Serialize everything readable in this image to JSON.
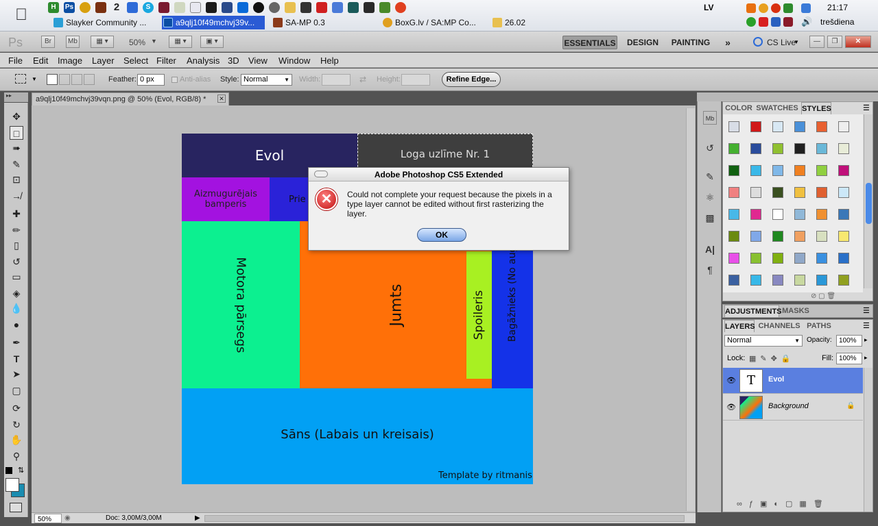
{
  "taskbar": {
    "tasks": [
      {
        "label": "Slayker Community ...",
        "color": "#2a9fd6"
      },
      {
        "label": "a9qlj10f49mchvj39v...",
        "color": "#0a4ea3"
      },
      {
        "label": "SA-MP 0.3",
        "color": "#8b3a1a"
      },
      {
        "label": "BoxG.lv / SA:MP Co...",
        "color": "#e0a020"
      },
      {
        "label": "26.02",
        "color": "#e8c050"
      }
    ],
    "language": "LV",
    "time": "21:17",
    "day": "trešdiena"
  },
  "appbar": {
    "logo": "Ps",
    "bridge": "Br",
    "minibridge": "Mb",
    "zoom": "50%",
    "workspaces": [
      "ESSENTIALS",
      "DESIGN",
      "PAINTING"
    ],
    "more": "»",
    "cslive": "CS Live"
  },
  "menu": [
    "File",
    "Edit",
    "Image",
    "Layer",
    "Select",
    "Filter",
    "Analysis",
    "3D",
    "View",
    "Window",
    "Help"
  ],
  "options": {
    "feather_label": "Feather:",
    "feather_value": "0 px",
    "antialias": "Anti-alias",
    "style_label": "Style:",
    "style_value": "Normal",
    "width_label": "Width:",
    "height_label": "Height:",
    "refine": "Refine Edge..."
  },
  "document": {
    "tab": "a9qlj10f49mchvj39vqn.png @ 50% (Evol, RGB/8) *",
    "status_zoom": "50%",
    "status_doc": "Doc: 3,00M/3,00M"
  },
  "canvas_blocks": {
    "evol": "Evol",
    "logo": "Loga uzlīme Nr. 1",
    "rear_bumper": "Aizmugurējais bamperis",
    "front_bumper": "Prie bamperis",
    "hood": "Motora pārsegs",
    "roof": "Jumts",
    "spoiler": "Spoileris",
    "trunk": "Bagāžnieks (No augšas)",
    "sides": "Sāns (Labais un kreisais)",
    "template": "Template by ritmanis"
  },
  "dialog": {
    "title": "Adobe Photoshop CS5 Extended",
    "message": "Could not complete your request because the pixels in a type layer cannot be edited without first rasterizing the layer.",
    "ok": "OK"
  },
  "panels": {
    "color_tabs": [
      "COLOR",
      "SWATCHES",
      "STYLES"
    ],
    "adj_tabs": [
      "ADJUSTMENTS",
      "MASKS"
    ],
    "layer_tabs": [
      "LAYERS",
      "CHANNELS",
      "PATHS"
    ],
    "blend_mode": "Normal",
    "opacity_label": "Opacity:",
    "opacity_value": "100%",
    "lock_label": "Lock:",
    "fill_label": "Fill:",
    "fill_value": "100%",
    "layers": [
      {
        "name": "Evol",
        "selected": true
      },
      {
        "name": "Background",
        "selected": false
      }
    ]
  }
}
